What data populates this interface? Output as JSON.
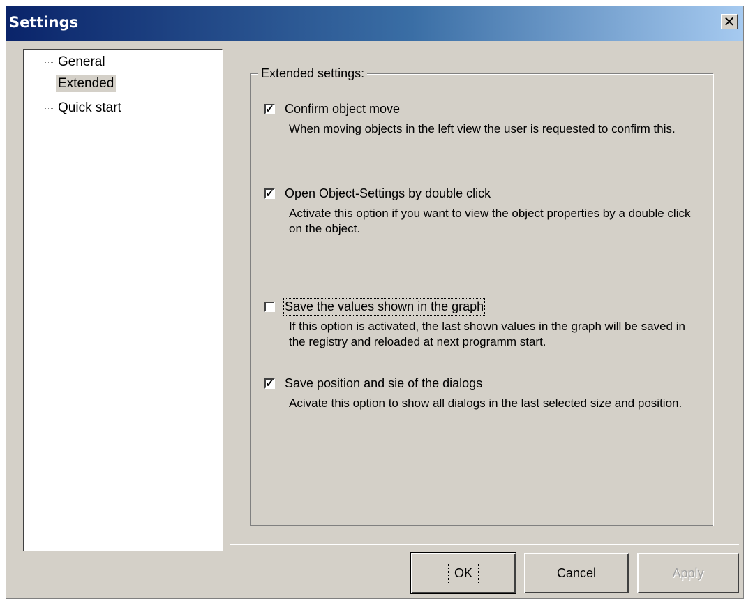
{
  "window": {
    "title": "Settings",
    "close_glyph": "✕"
  },
  "tree": {
    "items": [
      {
        "label": "General",
        "selected": false
      },
      {
        "label": "Extended",
        "selected": true
      },
      {
        "label": "Quick start",
        "selected": false
      }
    ]
  },
  "group": {
    "title": "Extended settings:",
    "options": [
      {
        "label": "Confirm object move",
        "checked": true,
        "description": "When moving objects in the left view the user is requested to confirm this."
      },
      {
        "label": "Open Object-Settings by double click",
        "checked": true,
        "description": "Activate this option if you want to view the object properties by a double click on the object."
      },
      {
        "label": "Save the values shown in the graph",
        "checked": false,
        "description": "If this option is activated, the last shown values in the graph will be saved in the registry and reloaded at next programm start."
      },
      {
        "label": "Save position and sie of the dialogs",
        "checked": true,
        "description": "Acivate this option to show all dialogs in the last selected size and position."
      }
    ]
  },
  "buttons": {
    "ok": "OK",
    "cancel": "Cancel",
    "apply": "Apply"
  },
  "colors": {
    "face": "#d4d0c8",
    "title_start": "#0a246a",
    "title_end": "#a6caf0"
  }
}
